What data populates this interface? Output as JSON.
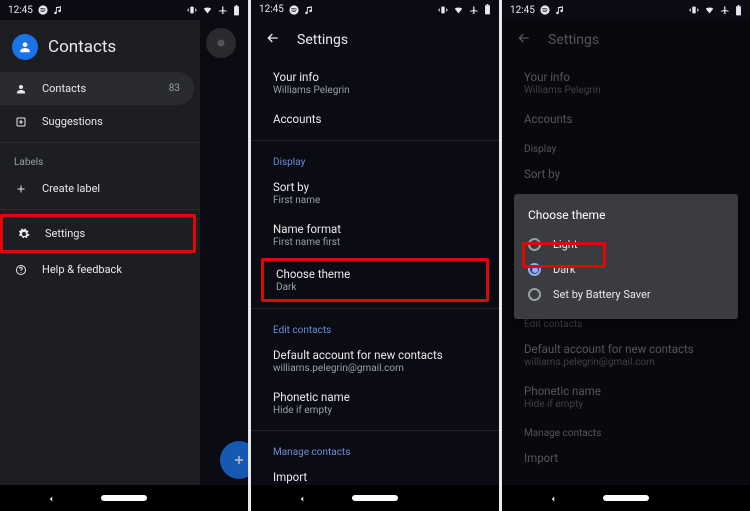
{
  "status": {
    "time": "12:45"
  },
  "screen1": {
    "app_title": "Contacts",
    "items": {
      "contacts": {
        "label": "Contacts",
        "count": "83"
      },
      "suggestions": {
        "label": "Suggestions"
      },
      "labels_header": "Labels",
      "create_label": "Create label",
      "settings": {
        "label": "Settings"
      },
      "help": {
        "label": "Help & feedback"
      }
    }
  },
  "screen2": {
    "header": "Settings",
    "your_info": {
      "title": "Your info",
      "sub": "Williams Pelegrin"
    },
    "accounts": {
      "title": "Accounts"
    },
    "display_section": "Display",
    "sort_by": {
      "title": "Sort by",
      "sub": "First name"
    },
    "name_format": {
      "title": "Name format",
      "sub": "First name first"
    },
    "choose_theme": {
      "title": "Choose theme",
      "sub": "Dark"
    },
    "edit_section": "Edit contacts",
    "default_account": {
      "title": "Default account for new contacts",
      "sub": "williams.pelegrin@gmail.com"
    },
    "phonetic": {
      "title": "Phonetic name",
      "sub": "Hide if empty"
    },
    "manage_section": "Manage contacts",
    "import": {
      "title": "Import"
    }
  },
  "dialog": {
    "title": "Choose theme",
    "options": {
      "light": "Light",
      "dark": "Dark",
      "battery": "Set by Battery Saver"
    }
  }
}
